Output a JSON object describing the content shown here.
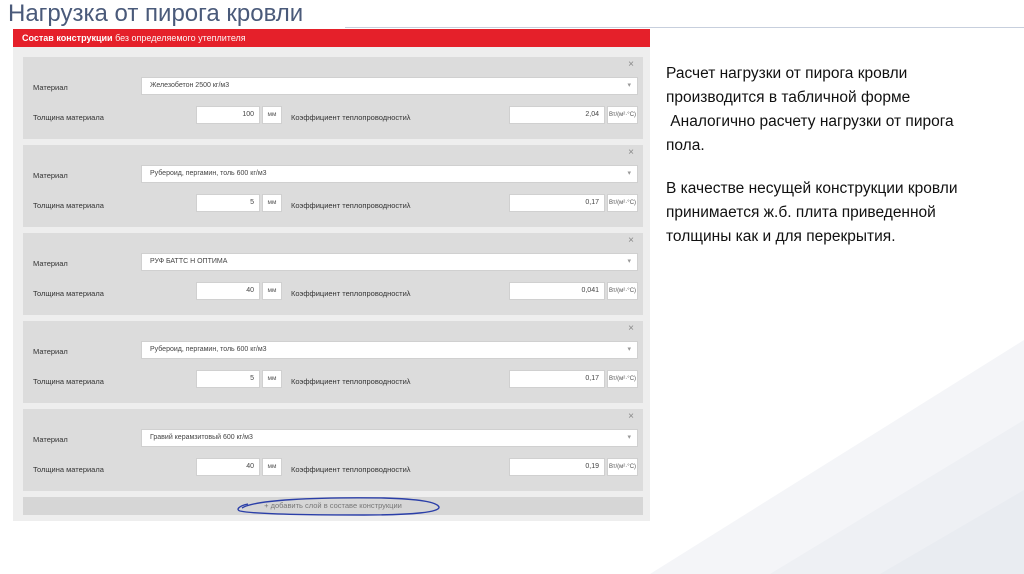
{
  "slide": {
    "title": "Нагрузка от пирога кровли"
  },
  "panel": {
    "header_bold": "Состав конструкции",
    "header_sub": " без определяемого утеплителя",
    "add_layer_label": "+ добавить слой в составе конструкции",
    "labels": {
      "material": "Материал",
      "thickness": "Толщина материала",
      "conductivity": "Коэффициент теплопроводностиλ",
      "thickness_unit": "мм",
      "conductivity_unit": "Вт/(м²·°С)",
      "close": "×",
      "caret": "▾"
    },
    "layers": [
      {
        "material": "Железобетон 2500 кг/м3",
        "thickness": "100",
        "conductivity": "2,04"
      },
      {
        "material": "Рубероид, пергамин, толь 600 кг/м3",
        "thickness": "5",
        "conductivity": "0,17"
      },
      {
        "material": "РУФ БАТТС Н ОПТИМА",
        "thickness": "40",
        "conductivity": "0,041"
      },
      {
        "material": "Рубероид, пергамин, толь 600 кг/м3",
        "thickness": "5",
        "conductivity": "0,17"
      },
      {
        "material": "Гравий керамзитовый 600 кг/м3",
        "thickness": "40",
        "conductivity": "0,19"
      }
    ]
  },
  "description": {
    "paragraph1": [
      "Расчет нагрузки от пирога кровли",
      "производится в табличной форме",
      " Аналогично расчету нагрузки от пирога",
      "пола."
    ],
    "paragraph2": [
      "В качестве несущей конструкции кровли",
      "принимается ж.б. плита приведенной",
      "толщины как и для перекрытия."
    ]
  },
  "colors": {
    "header_red": "#e5202a",
    "title_blue": "#4a5a7a",
    "annotation_blue": "#2b3fa8"
  }
}
